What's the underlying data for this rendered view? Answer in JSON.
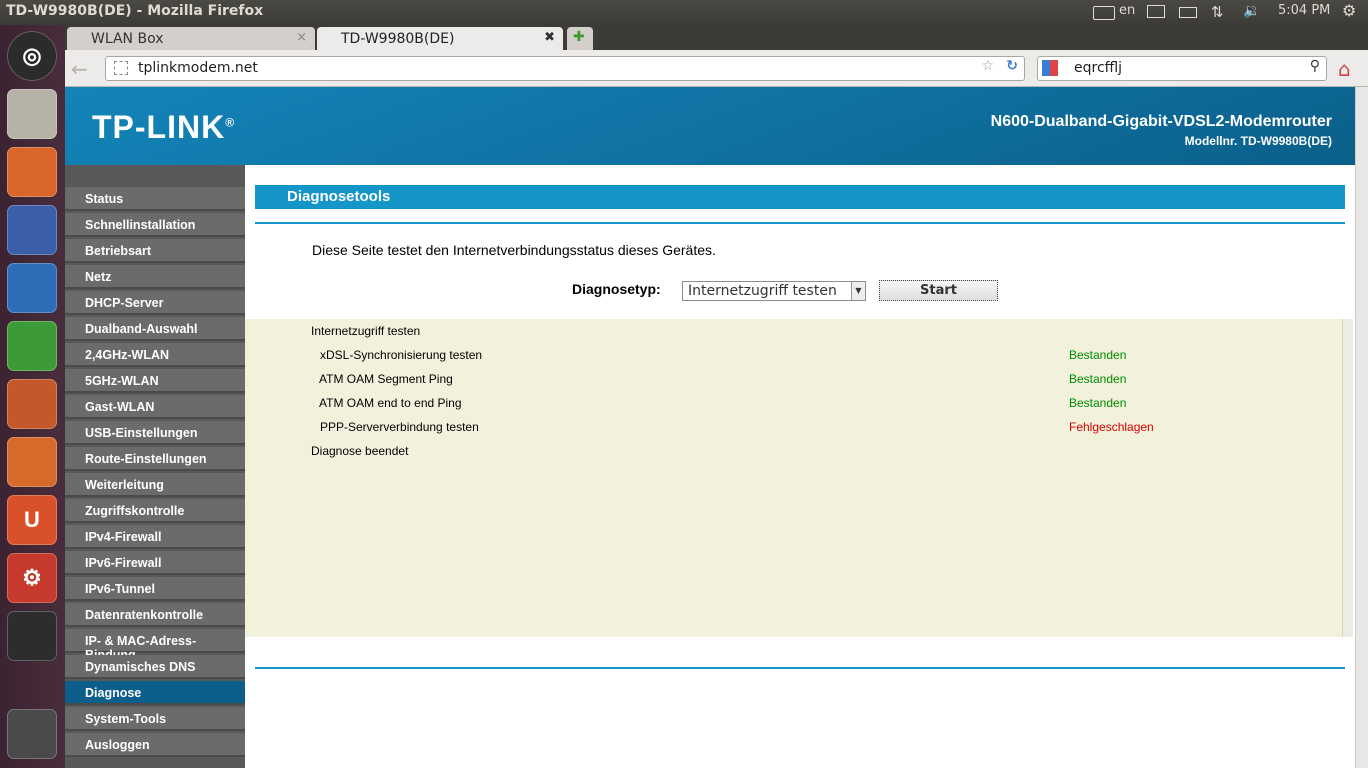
{
  "panel": {
    "window_title": "TD-W9980B(DE) - Mozilla Firefox",
    "lang": "en",
    "time": "5:04 PM",
    "icons": [
      "keyboard-icon",
      "mail-icon",
      "battery-icon",
      "network-icon",
      "volume-icon",
      "gear-icon"
    ]
  },
  "launcher": {
    "icons": [
      "ubuntu-dash-icon",
      "installer-icon",
      "files-icon",
      "firefox-icon",
      "writer-icon",
      "calc-icon",
      "impress-icon",
      "software-center-icon",
      "ubuntu-one-icon",
      "settings-icon",
      "workspace-icon",
      "trash-icon"
    ]
  },
  "tabs": [
    {
      "label": "WLAN Box",
      "close": "×",
      "active": false
    },
    {
      "label": "TD-W9980B(DE)",
      "close": "✖",
      "active": true
    }
  ],
  "new_tab": "✚",
  "url": "tplinkmodem.net",
  "search": "eqrcfflj",
  "header": {
    "logo": "TP-LINK",
    "logo_mark": "®",
    "model_name": "N600-Dualband-Gigabit-VDSL2-Modemrouter",
    "model_no": "Modellnr. TD-W9980B(DE)"
  },
  "menu": [
    "Status",
    "Schnellinstallation",
    "Betriebsart",
    "Netz",
    "DHCP-Server",
    "Dualband-Auswahl",
    "2,4GHz-WLAN",
    "5GHz-WLAN",
    "Gast-WLAN",
    "USB-Einstellungen",
    "Route-Einstellungen",
    "Weiterleitung",
    "Zugriffskontrolle",
    "IPv4-Firewall",
    "IPv6-Firewall",
    "IPv6-Tunnel",
    "Datenratenkontrolle",
    "IP- & MAC-Adress-Bindung",
    "Dynamisches DNS",
    "Diagnose",
    "System-Tools",
    "Ausloggen"
  ],
  "active_menu": "Diagnose",
  "content": {
    "title": "Diagnosetools",
    "description": "Diese Seite testet den Internetverbindungsstatus dieses Gerätes.",
    "diag_label": "Diagnosetyp:",
    "diag_value": "Internetzugriff testen",
    "start_label": "Start"
  },
  "results": {
    "header": "Internetzugriff testen",
    "rows": [
      {
        "name": "xDSL-Synchronisierung testen",
        "status": "Bestanden",
        "ok": true
      },
      {
        "name": "ATM OAM Segment Ping",
        "status": "Bestanden",
        "ok": true
      },
      {
        "name": "ATM OAM end to end Ping",
        "status": "Bestanden",
        "ok": true
      },
      {
        "name": "PPP-Serververbindung testen",
        "status": "Fehlgeschlagen",
        "ok": false
      }
    ],
    "footer": "Diagnose beendet"
  }
}
